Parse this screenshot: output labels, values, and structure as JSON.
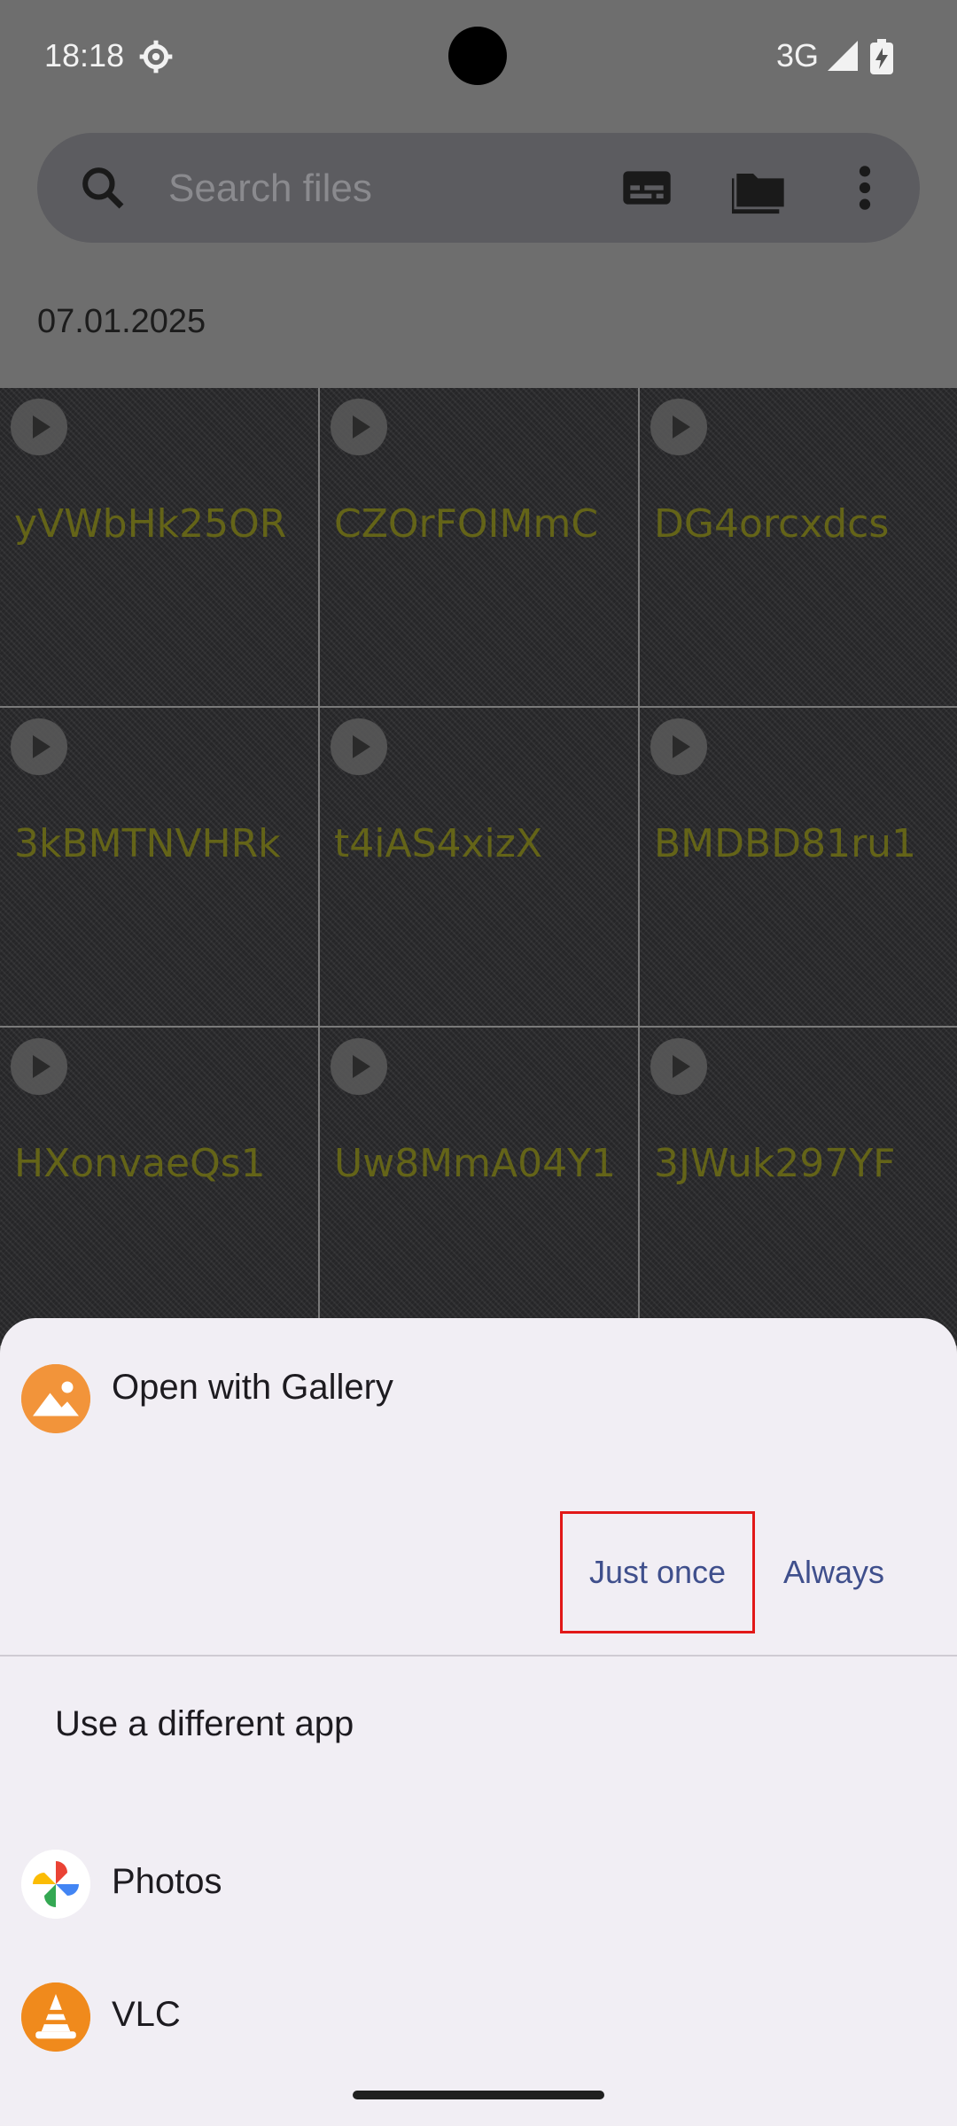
{
  "status_bar": {
    "time": "18:18",
    "network": "3G",
    "icons": [
      "settings-gear-icon",
      "signal-icon",
      "battery-charging-icon"
    ]
  },
  "toolbar": {
    "search_placeholder": "Search files",
    "icons": [
      "search-icon",
      "subtitles-icon",
      "folder-icon",
      "more-vert-icon"
    ]
  },
  "date_header": "07.01.2025",
  "files": [
    {
      "name": "yVWbHk25OR"
    },
    {
      "name": "CZOrFOIMmC"
    },
    {
      "name": "DG4orcxdcs"
    },
    {
      "name": "3kBMTNVHRk"
    },
    {
      "name": "t4iAS4xizX"
    },
    {
      "name": "BMDBD81ru1"
    },
    {
      "name": "HXonvaeQs1"
    },
    {
      "name": "Uw8MmA04Y1"
    },
    {
      "name": "3JWuk297YF"
    }
  ],
  "sheet": {
    "title": "Open with Gallery",
    "just_once": "Just once",
    "always": "Always",
    "different_app": "Use a different app",
    "apps": [
      {
        "label": "Photos",
        "icon": "photos-icon"
      },
      {
        "label": "VLC",
        "icon": "vlc-icon"
      }
    ],
    "colors": {
      "accent": "#3f4f8c",
      "highlight": "#e21818",
      "sheet_bg": "#f1eef4"
    }
  }
}
